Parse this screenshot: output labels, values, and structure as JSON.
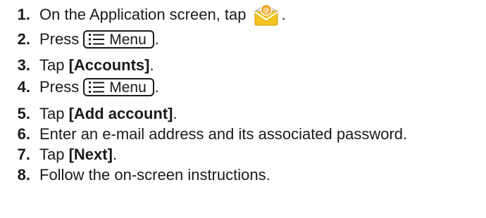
{
  "steps": [
    {
      "number": "1.",
      "before": "On the Application screen, tap",
      "after": "."
    },
    {
      "number": "2.",
      "before": "Press",
      "after": "."
    },
    {
      "number": "3.",
      "before": "Tap ",
      "bold": "[Accounts]",
      "after": "."
    },
    {
      "number": "4.",
      "before": "Press",
      "after": "."
    },
    {
      "number": "5.",
      "before": "Tap ",
      "bold": "[Add account]",
      "after": "."
    },
    {
      "number": "6.",
      "before": "Enter an e-mail address and its associated password.",
      "after": ""
    },
    {
      "number": "7.",
      "before": "Tap ",
      "bold": "[Next]",
      "after": "."
    },
    {
      "number": "8.",
      "before": "Follow the on-screen instructions.",
      "after": ""
    }
  ],
  "menu_key": {
    "label": "Menu",
    "icon": "menu-list-icon"
  },
  "email_app_icon": {
    "icon": "email-app-icon",
    "glyph": "@",
    "envelope_color": "#f0c020",
    "badge_color": "#f39c12"
  }
}
